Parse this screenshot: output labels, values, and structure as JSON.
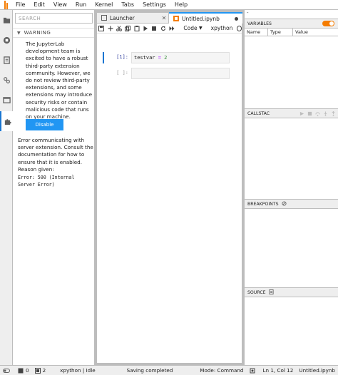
{
  "menubar": {
    "items": [
      "File",
      "Edit",
      "View",
      "Run",
      "Kernel",
      "Tabs",
      "Settings",
      "Help"
    ]
  },
  "extensions": {
    "search_placeholder": "SEARCH",
    "warning_title": "WARNING",
    "warning_text": "The JupyterLab development team is excited to have a robust third-party extension community. However, we do not review third-party extensions, and some extensions may introduce security risks or contain malicious code that runs on your machine.",
    "disable_label": "Disable",
    "error_text": "Error communicating with server extension. Consult the documentation for how to ensure that it is enabled.",
    "reason_label": "Reason given:",
    "error_code": "Error: 500 (Internal Server Error)"
  },
  "tabs": [
    {
      "label": "Launcher"
    },
    {
      "label": "Untitled.ipynb"
    }
  ],
  "notebook": {
    "cell_type": "Code",
    "kernel": "xpython",
    "cells": [
      {
        "prompt": "[1]:",
        "code_var": "testvar",
        "code_op": " = ",
        "code_num": "2"
      },
      {
        "prompt": "[ ]:"
      }
    ]
  },
  "debugger": {
    "top_label": "-",
    "variables": "VARIABLES",
    "columns": [
      "Name",
      "Type",
      "Value"
    ],
    "callstack": "CALLSTAC",
    "breakpoints": "BREAKPOINTS",
    "source": "SOURCE"
  },
  "statusbar": {
    "mode_count": "0",
    "kernel_count": "2",
    "kernel_status": "xpython | Idle",
    "saving": "Saving completed",
    "mode": "Mode: Command",
    "position": "Ln 1, Col 12",
    "filename": "Untitled.ipynb"
  },
  "colors": {
    "accent": "#2196f3",
    "toggle": "#f57c00"
  }
}
